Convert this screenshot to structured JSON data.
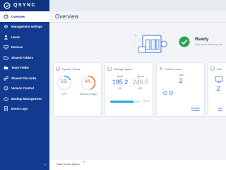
{
  "app": {
    "brand": "QSYNC",
    "logo_icon": "qsync-logo-icon",
    "colors": {
      "sidebar": "#123a8f",
      "accent_blue": "#27a9df",
      "accent_orange": "#f07a3a",
      "success_green": "#2ba34b",
      "link": "#2d6bd4"
    }
  },
  "sidebar": {
    "items": [
      {
        "label": "Overview",
        "icon": "gauge-icon",
        "active": true
      },
      {
        "label": "Management settings",
        "icon": "settings-icon",
        "active": false
      },
      {
        "label": "Users",
        "icon": "user-icon",
        "active": false
      },
      {
        "label": "Devices",
        "icon": "devices-icon",
        "active": false
      },
      {
        "label": "Shared Folders",
        "icon": "folder-icon",
        "active": false
      },
      {
        "label": "Team Folder",
        "icon": "team-folder-icon",
        "active": false
      },
      {
        "label": "Shared File Links",
        "icon": "link-icon",
        "active": false
      },
      {
        "label": "Version Control",
        "icon": "version-icon",
        "active": false
      },
      {
        "label": "Backup Management",
        "icon": "backup-icon",
        "active": false
      },
      {
        "label": "Event Logs",
        "icon": "log-icon",
        "active": false
      }
    ],
    "collapse_icon": "double-chevron-left-icon"
  },
  "page": {
    "title": "Overview"
  },
  "status": {
    "title": "Ready",
    "subtitle": "Sync your files anywhe",
    "icon": "check-circle-icon"
  },
  "cards": {
    "system_status": {
      "title": "System Status",
      "cpu": {
        "value": "18",
        "unit": "%",
        "label": "CPU",
        "percent": 18,
        "color": "#27a9df"
      },
      "memory": {
        "value": "44",
        "unit": "%",
        "label": "Memory Usage",
        "percent": 44,
        "color": "#f07a3a"
      }
    },
    "storage": {
      "title": "Storage Space",
      "used_label": "Used",
      "used_value": "195.2",
      "used_unit": "GB",
      "quota_label": "Quota",
      "quota_value": "246.5",
      "quota_unit": "GB",
      "percent_text": "79 %",
      "percent": 79
    },
    "online_users": {
      "title": "Online Users",
      "total_label": "Total",
      "total_value": "2",
      "details_link": "Details"
    },
    "devices": {
      "title": "Onli",
      "total_value": "2",
      "details_link": "Det"
    }
  },
  "bottombar": {
    "start_text": "Start to use Qsync",
    "chevron_icon": "chevron-up-icon"
  }
}
